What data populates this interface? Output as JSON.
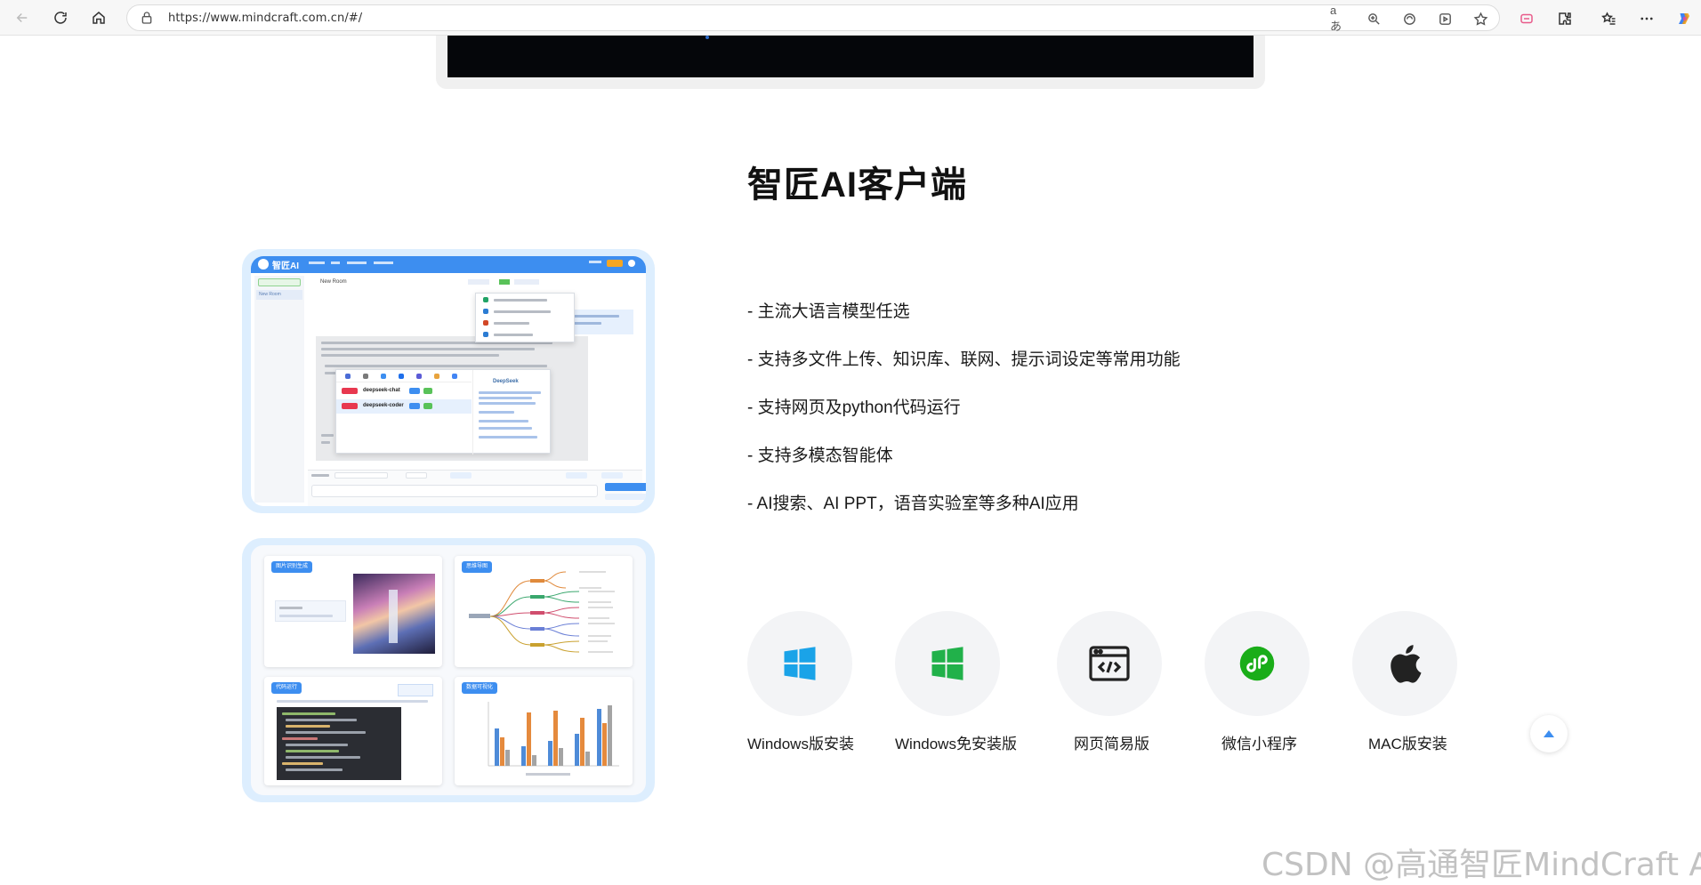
{
  "browser": {
    "url": "https://www.mindcraft.com.cn/#/"
  },
  "section": {
    "title": "智匠AI客户端"
  },
  "features": [
    "- 主流大语言模型任选",
    "- 支持多文件上传、知识库、联网、提示词设定等常用功能",
    "- 支持网页及python代码运行",
    "- 支持多模态智能体",
    "- AI搜索、AI PPT，语音实验室等多种AI应用"
  ],
  "install_options": [
    {
      "label": "Windows版安装",
      "icon": "windows-icon",
      "color": "#1aa3e8"
    },
    {
      "label": "Windows免安装版",
      "icon": "windows-icon",
      "color": "#21b14a"
    },
    {
      "label": "网页简易版",
      "icon": "web-code-icon",
      "color": "#222222"
    },
    {
      "label": "微信小程序",
      "icon": "wechat-miniprogram-icon",
      "color": "#1aad19"
    },
    {
      "label": "MAC版安装",
      "icon": "apple-icon",
      "color": "#222222"
    }
  ],
  "app_preview": {
    "logo_text": "智匠AI",
    "room_title": "New Room",
    "sidebar_item": "New Room",
    "models": [
      "deepseek-chat",
      "deepseek-coder"
    ],
    "model_panel_title": "DeepSeek"
  },
  "feature_cards": [
    {
      "tag": "图片识别生成"
    },
    {
      "tag": "思维导图"
    },
    {
      "tag": "代码运行"
    },
    {
      "tag": "数据可视化"
    }
  ],
  "watermark": "CSDN @高通智匠MindCraft AI",
  "colors": {
    "accent": "#3d8ef0",
    "frame": "#ddeefe"
  }
}
